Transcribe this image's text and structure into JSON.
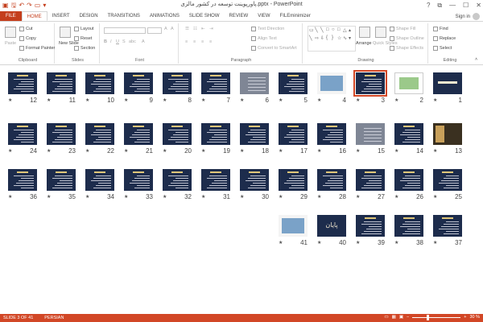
{
  "window": {
    "title": "پاورپوینت توسعه در کشور مالزی.pptx - PowerPoint",
    "help": "?",
    "restore": "⧉",
    "minimize": "—",
    "maximize": "☐",
    "close": "✕"
  },
  "qat": [
    "save-icon",
    "undo-icon",
    "redo-icon",
    "start-from-beginning-icon",
    "customize-icon"
  ],
  "tabs": [
    "FILE",
    "HOME",
    "INSERT",
    "DESIGN",
    "TRANSITIONS",
    "ANIMATIONS",
    "SLIDE SHOW",
    "REVIEW",
    "VIEW",
    "FILEminimizer"
  ],
  "active_tab": "HOME",
  "sign_in": "Sign in",
  "ribbon": {
    "clipboard": {
      "label": "Clipboard",
      "paste": "Paste",
      "cut": "Cut",
      "copy": "Copy",
      "format_painter": "Format Painter"
    },
    "slides": {
      "label": "Slides",
      "new_slide": "New Slide",
      "layout": "Layout",
      "reset": "Reset",
      "section": "Section"
    },
    "font": {
      "label": "Font"
    },
    "paragraph": {
      "label": "Paragraph",
      "text_direction": "Text Direction",
      "align_text": "Align Text",
      "convert_smartart": "Convert to SmartArt"
    },
    "drawing": {
      "label": "Drawing",
      "arrange": "Arrange",
      "quick_styles": "Quick Styles",
      "shape_fill": "Shape Fill",
      "shape_outline": "Shape Outline",
      "shape_effects": "Shape Effects"
    },
    "editing": {
      "label": "Editing",
      "find": "Find",
      "replace": "Replace",
      "select": "Select"
    }
  },
  "slides": [
    {
      "n": "1",
      "kind": "title-slide"
    },
    {
      "n": "2",
      "kind": "white-diagram"
    },
    {
      "n": "3",
      "kind": "dark-text",
      "selected": true
    },
    {
      "n": "4",
      "kind": "photo"
    },
    {
      "n": "5",
      "kind": "dark-text"
    },
    {
      "n": "6",
      "kind": "gray"
    },
    {
      "n": "7",
      "kind": "dark-text"
    },
    {
      "n": "8",
      "kind": "dark-text"
    },
    {
      "n": "9",
      "kind": "dark-text"
    },
    {
      "n": "10",
      "kind": "dark-text"
    },
    {
      "n": "11",
      "kind": "dark-text"
    },
    {
      "n": "12",
      "kind": "dark-text"
    },
    {
      "n": "13",
      "kind": "gold-photo"
    },
    {
      "n": "14",
      "kind": "dark-text"
    },
    {
      "n": "15",
      "kind": "gray"
    },
    {
      "n": "16",
      "kind": "dark-text"
    },
    {
      "n": "17",
      "kind": "dark-text"
    },
    {
      "n": "18",
      "kind": "dark-text"
    },
    {
      "n": "19",
      "kind": "dark-text"
    },
    {
      "n": "20",
      "kind": "dark-text"
    },
    {
      "n": "21",
      "kind": "dark-text"
    },
    {
      "n": "22",
      "kind": "dark-text"
    },
    {
      "n": "23",
      "kind": "dark-text"
    },
    {
      "n": "24",
      "kind": "dark-text"
    },
    {
      "n": "25",
      "kind": "dark-text"
    },
    {
      "n": "26",
      "kind": "dark-text"
    },
    {
      "n": "27",
      "kind": "dark-text"
    },
    {
      "n": "28",
      "kind": "dark-text"
    },
    {
      "n": "29",
      "kind": "dark-text"
    },
    {
      "n": "30",
      "kind": "dark-text"
    },
    {
      "n": "31",
      "kind": "dark-text"
    },
    {
      "n": "32",
      "kind": "dark-text"
    },
    {
      "n": "33",
      "kind": "dark-text"
    },
    {
      "n": "34",
      "kind": "dark-text"
    },
    {
      "n": "35",
      "kind": "dark-text"
    },
    {
      "n": "36",
      "kind": "dark-text"
    },
    {
      "n": "37",
      "kind": "dark-text"
    },
    {
      "n": "38",
      "kind": "dark-text"
    },
    {
      "n": "39",
      "kind": "dark-text"
    },
    {
      "n": "40",
      "kind": "title-slide",
      "text": "پایان"
    },
    {
      "n": "41",
      "kind": "photo"
    }
  ],
  "status": {
    "slide_of": "SLIDE 3 OF 41",
    "language": "PERSIAN",
    "zoom": "30 %"
  },
  "colors": {
    "accent": "#d24726",
    "slide_bg": "#1d2c4c"
  }
}
